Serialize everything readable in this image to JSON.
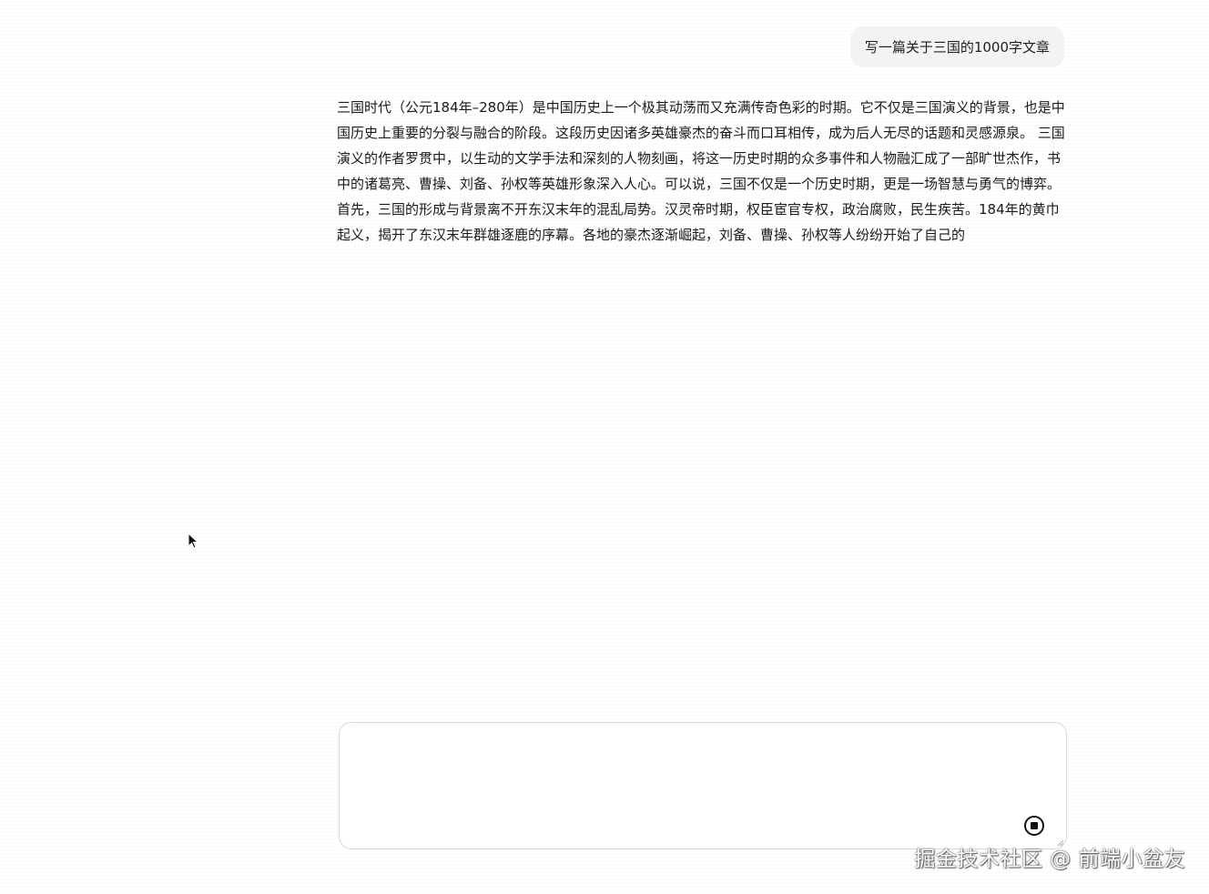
{
  "conversation": {
    "user_message": "写一篇关于三国的1000字文章",
    "assistant_reply": "三国时代（公元184年–280年）是中国历史上一个极其动荡而又充满传奇色彩的时期。它不仅是三国演义的背景，也是中国历史上重要的分裂与融合的阶段。这段历史因诸多英雄豪杰的奋斗而口耳相传，成为后人无尽的话题和灵感源泉。 三国演义的作者罗贯中，以生动的文学手法和深刻的人物刻画，将这一历史时期的众多事件和人物融汇成了一部旷世杰作，书中的诸葛亮、曹操、刘备、孙权等英雄形象深入人心。可以说，三国不仅是一个历史时期，更是一场智慧与勇气的博弈。 首先，三国的形成与背景离不开东汉末年的混乱局势。汉灵帝时期，权臣宦官专权，政治腐败，民生疾苦。184年的黄巾起义，揭开了东汉末年群雄逐鹿的序幕。各地的豪杰逐渐崛起，刘备、曹操、孙权等人纷纷开始了自己的"
  },
  "composer": {
    "value": "",
    "placeholder": "",
    "stop_icon": "stop-circle-icon"
  },
  "watermark": {
    "text": "掘金技术社区 @ 前端小盆友"
  }
}
